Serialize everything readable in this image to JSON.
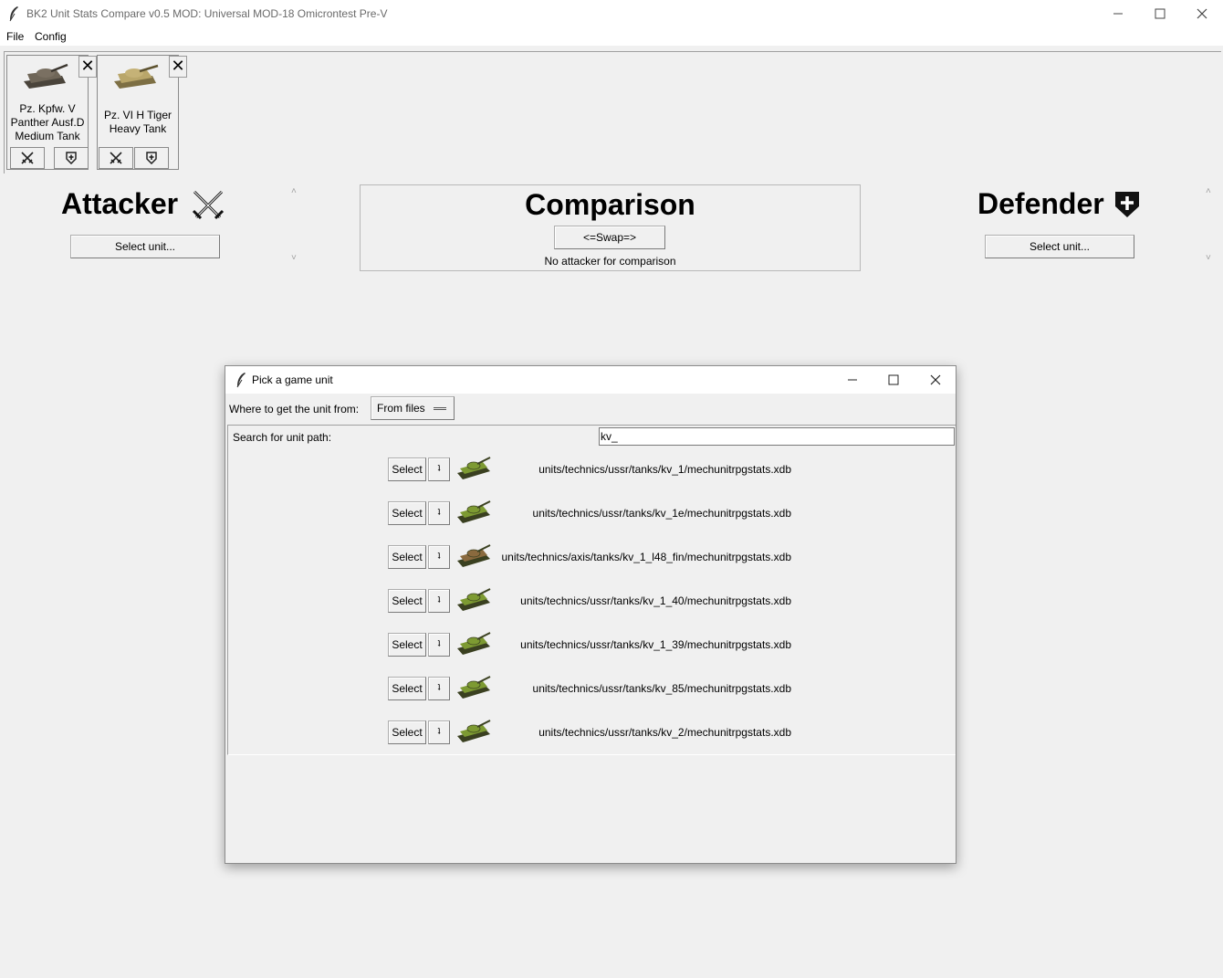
{
  "window": {
    "title": "BK2 Unit Stats Compare v0.5 MOD: Universal MOD-18 Omicrontest Pre-V",
    "controls": {
      "minimize": "—",
      "maximize": "☐",
      "close": "✕"
    }
  },
  "menu": [
    {
      "label": "File"
    },
    {
      "label": "Config"
    }
  ],
  "unit_cards": [
    {
      "name_lines": [
        "Pz. Kpfw. V",
        "Panther Ausf.D",
        "Medium Tank"
      ],
      "icon": "tank-icon",
      "colors": {
        "body": "#6f6658",
        "hull": "#4a443b"
      }
    },
    {
      "name_lines": [
        "Pz. VI H Tiger",
        "Heavy Tank"
      ],
      "icon": "tank-icon",
      "colors": {
        "body": "#b9a66a",
        "hull": "#7d6f44"
      }
    }
  ],
  "attacker": {
    "title": "Attacker",
    "icon": "crossed-swords-icon",
    "select_label": "Select unit..."
  },
  "comparison": {
    "title": "Comparison",
    "swap_label": "<=Swap=>",
    "status": "No attacker for comparison"
  },
  "defender": {
    "title": "Defender",
    "icon": "shield-plus-icon",
    "select_label": "Select unit..."
  },
  "dialog": {
    "title": "Pick a game unit",
    "source_label": "Where to get the unit from:",
    "source_value": "From files",
    "search_label": "Search for unit path:",
    "search_value": "kv_",
    "select_label": "Select",
    "small_button_label": "ʇ",
    "results": [
      {
        "path": "units/technics/ussr/tanks/kv_1/mechunitrpgstats.xdb",
        "icon_color": "#7d9a32"
      },
      {
        "path": "units/technics/ussr/tanks/kv_1e/mechunitrpgstats.xdb",
        "icon_color": "#7d9a32"
      },
      {
        "path": "units/technics/axis/tanks/kv_1_l48_fin/mechunitrpgstats.xdb",
        "icon_color": "#8a6a3e"
      },
      {
        "path": "units/technics/ussr/tanks/kv_1_40/mechunitrpgstats.xdb",
        "icon_color": "#7d9a32"
      },
      {
        "path": "units/technics/ussr/tanks/kv_1_39/mechunitrpgstats.xdb",
        "icon_color": "#7d9a32"
      },
      {
        "path": "units/technics/ussr/tanks/kv_85/mechunitrpgstats.xdb",
        "icon_color": "#7d9a32"
      },
      {
        "path": "units/technics/ussr/tanks/kv_2/mechunitrpgstats.xdb",
        "icon_color": "#7d9a32"
      }
    ]
  }
}
